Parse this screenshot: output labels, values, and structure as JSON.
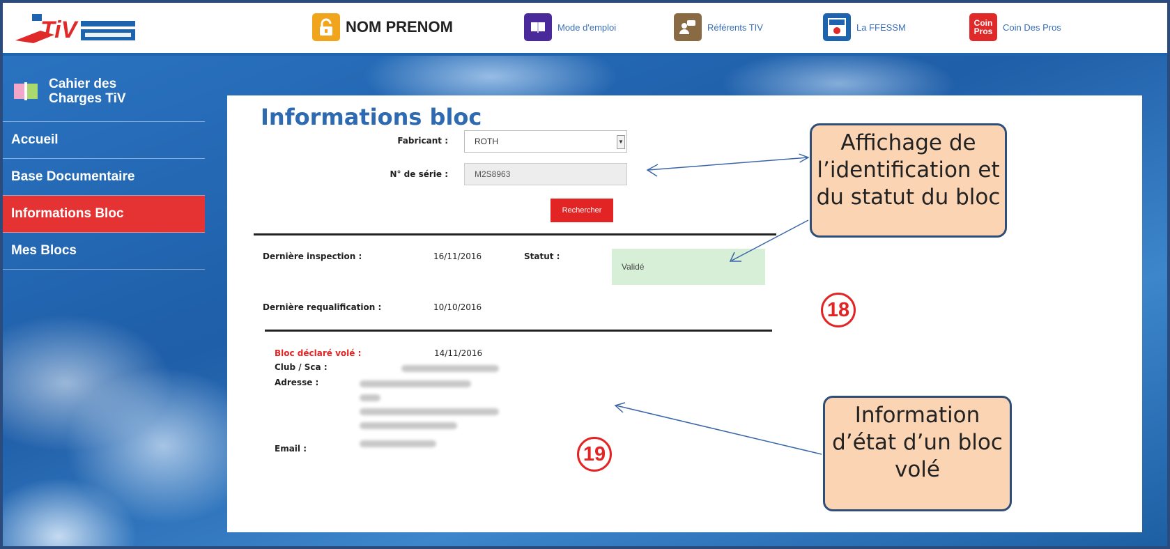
{
  "header": {
    "user_label": "NOM PRENOM",
    "links": [
      {
        "label": "Mode d'emploi",
        "icon": "guide-icon"
      },
      {
        "label": "Référents TIV",
        "icon": "referents-icon"
      },
      {
        "label": "La FFESSM",
        "icon": "ffessm-icon"
      },
      {
        "label": "Coin Des Pros",
        "icon": "pros-icon"
      }
    ],
    "pros_icon_text": "Coin Pros"
  },
  "sidebar": {
    "title": "Cahier des\nCharges TiV",
    "items": [
      {
        "label": "Accueil",
        "active": false
      },
      {
        "label": "Base Documentaire",
        "active": false
      },
      {
        "label": "Informations Bloc",
        "active": true
      },
      {
        "label": "Mes Blocs",
        "active": false
      }
    ]
  },
  "form": {
    "title": "Informations bloc",
    "fabricant_label": "Fabricant :",
    "fabricant_value": "ROTH",
    "serie_label": "N° de série :",
    "serie_value": "M2S8963",
    "search_label": "Rechercher"
  },
  "inspection": {
    "last_inspection_label": "Dernière inspection :",
    "last_inspection_value": "16/11/2016",
    "status_label": "Statut :",
    "status_value": "Validé",
    "last_requal_label": "Dernière requalification :",
    "last_requal_value": "10/10/2016"
  },
  "stolen": {
    "declared_label": "Bloc déclaré volé :",
    "declared_value": "14/11/2016",
    "club_label": "Club / Sca :",
    "address_label": "Adresse :",
    "email_label": "Email :"
  },
  "annotations": {
    "callout_1": "Affichage de l’identification et du statut du bloc",
    "callout_2": "Information d’état d’un bloc volé",
    "marker_1": "18",
    "marker_2": "19"
  },
  "colors": {
    "brand_blue": "#1e63ad",
    "active_red": "#e53232",
    "status_green": "#d6efd6",
    "callout_fill": "#fbd4b4"
  }
}
